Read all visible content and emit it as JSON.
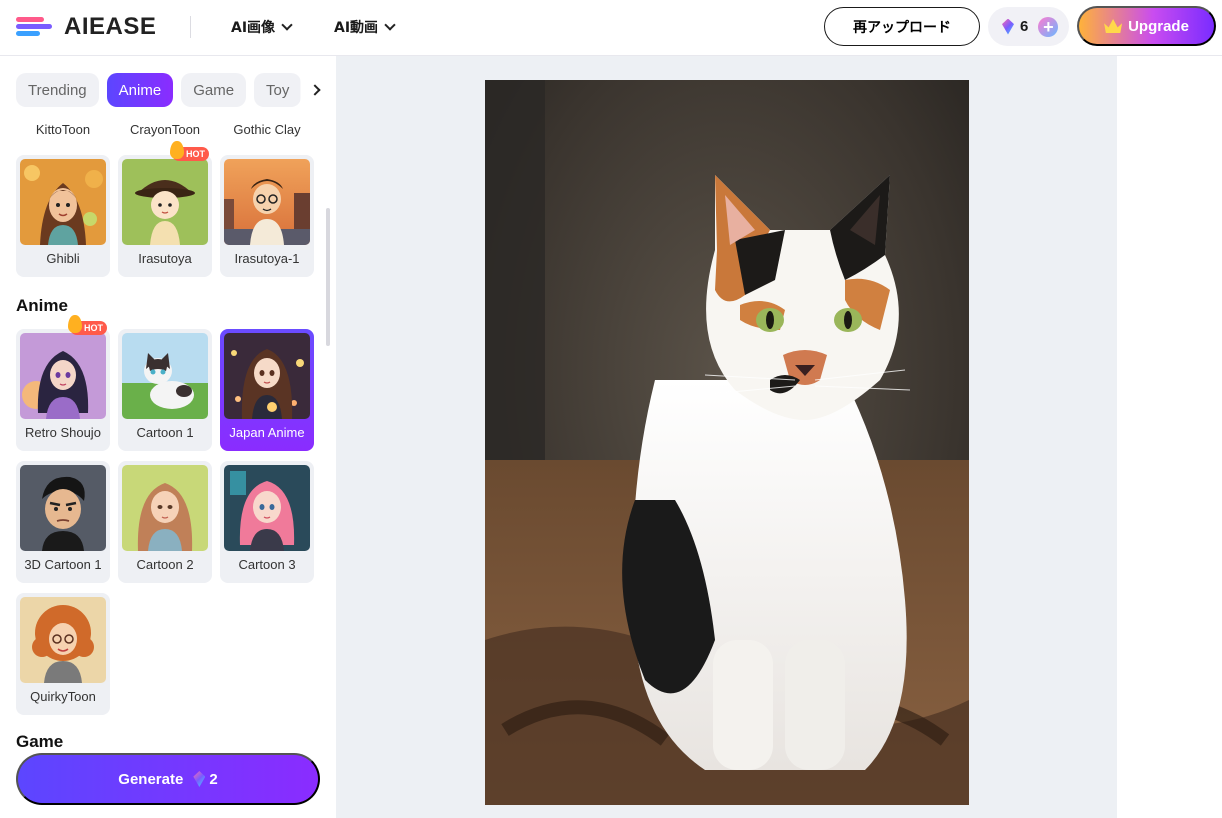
{
  "header": {
    "logo_text": "AIEASE",
    "nav": [
      {
        "label": "AI画像"
      },
      {
        "label": "AI動画"
      }
    ],
    "reupload_label": "再アップロード",
    "credits_count": "6",
    "upgrade_label": "Upgrade"
  },
  "sidebar": {
    "tabs": [
      {
        "label": "Trending",
        "active": false
      },
      {
        "label": "Anime",
        "active": true
      },
      {
        "label": "Game",
        "active": false
      },
      {
        "label": "Toy",
        "active": false
      }
    ],
    "top_labels": [
      "KittoToon",
      "CrayonToon",
      "Gothic Clay"
    ],
    "row1": [
      {
        "name": "Ghibli",
        "hot": false
      },
      {
        "name": "Irasutoya",
        "hot": true
      },
      {
        "name": "Irasutoya-1",
        "hot": false
      }
    ],
    "anime_section_title": "Anime",
    "hot_badge": "HOT",
    "anime_row1": [
      {
        "name": "Retro Shoujo",
        "hot": true
      },
      {
        "name": "Cartoon 1",
        "hot": false
      },
      {
        "name": "Japan Anime",
        "hot": false,
        "selected": true
      }
    ],
    "anime_row2": [
      {
        "name": "3D Cartoon 1"
      },
      {
        "name": "Cartoon 2"
      },
      {
        "name": "Cartoon 3"
      }
    ],
    "anime_row3": [
      {
        "name": "QuirkyToon"
      }
    ],
    "next_section_title": "Game",
    "generate_label": "Generate",
    "generate_cost": "2"
  },
  "colors": {
    "accent": "#6a3cff",
    "accent_end": "#8a2cff",
    "hot": "#ff5a4a"
  }
}
